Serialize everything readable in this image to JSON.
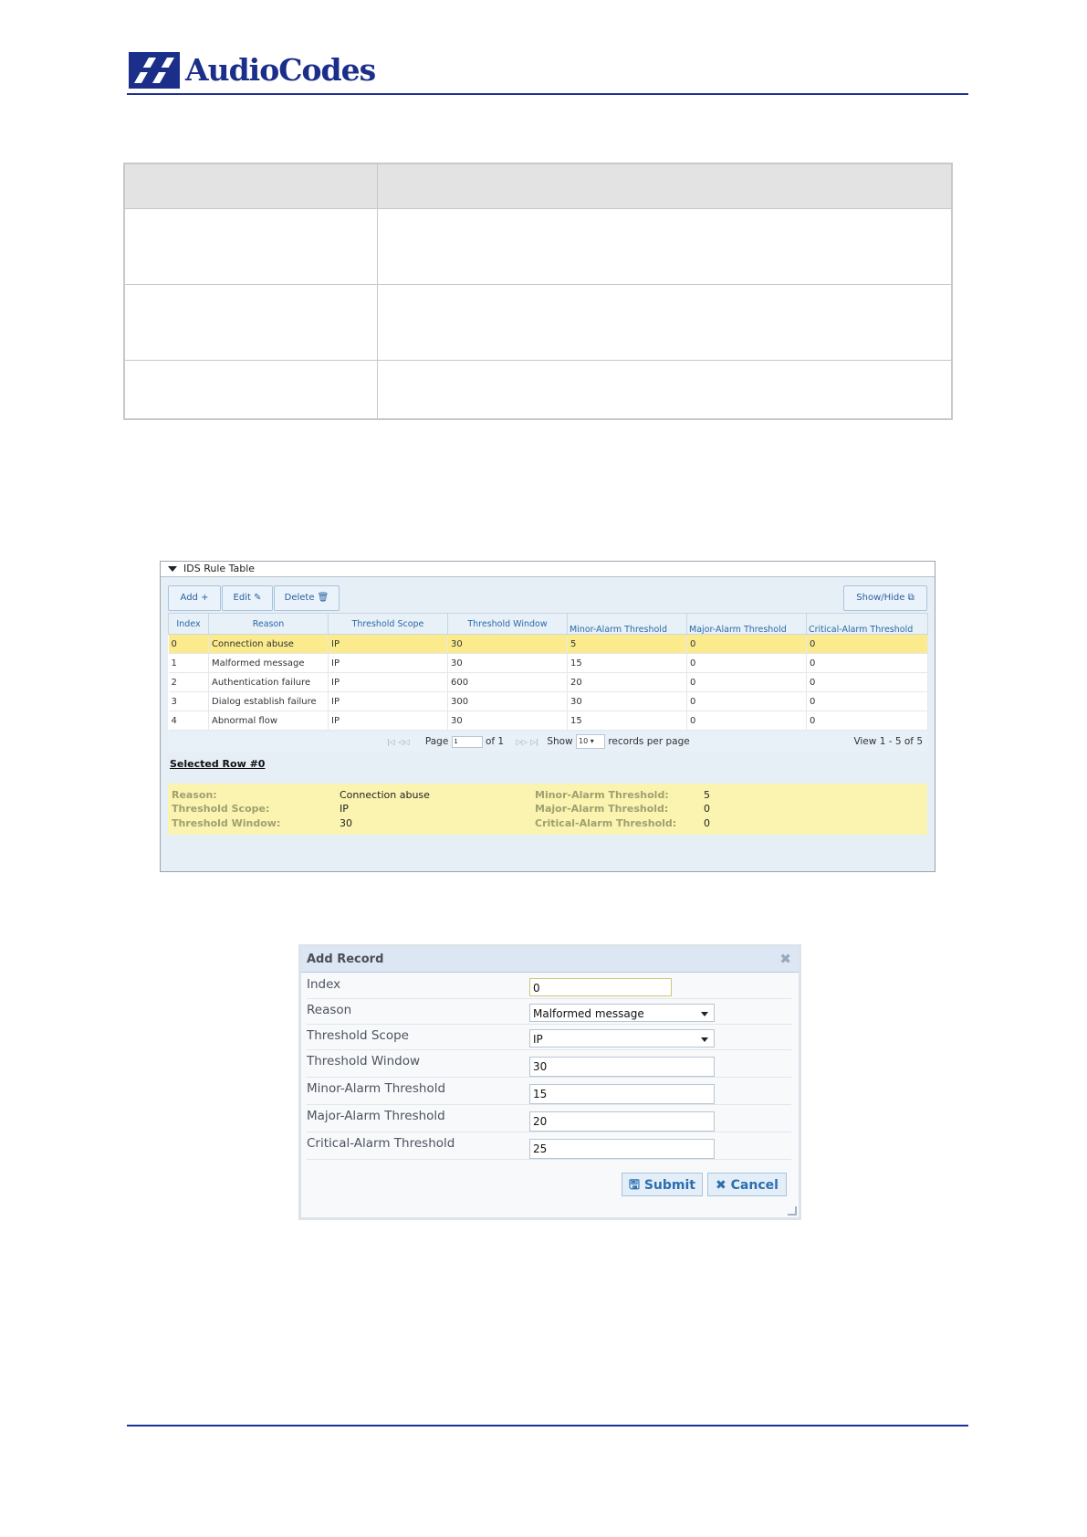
{
  "header": {
    "logo_text": "AudioCodes"
  },
  "ids_table": {
    "title": "IDS Rule Table",
    "toolbar": {
      "add": "Add +",
      "edit": "Edit ✎",
      "delete": "Delete 🗑",
      "show_hide": "Show/Hide ⧉"
    },
    "columns": [
      "Index",
      "Reason",
      "Threshold Scope",
      "Threshold Window",
      "Minor-Alarm Threshold",
      "Major-Alarm Threshold",
      "Critical-Alarm Threshold"
    ],
    "rows": [
      [
        "0",
        "Connection abuse",
        "IP",
        "30",
        "5",
        "0",
        "0"
      ],
      [
        "1",
        "Malformed message",
        "IP",
        "30",
        "15",
        "0",
        "0"
      ],
      [
        "2",
        "Authentication failure",
        "IP",
        "600",
        "20",
        "0",
        "0"
      ],
      [
        "3",
        "Dialog establish failure",
        "IP",
        "300",
        "30",
        "0",
        "0"
      ],
      [
        "4",
        "Abnormal flow",
        "IP",
        "30",
        "15",
        "0",
        "0"
      ]
    ],
    "pager": {
      "page_label": "Page",
      "page_value": "1",
      "of_label": "of 1",
      "show_label": "Show",
      "show_value": "10",
      "records_label": "records per page",
      "view_label": "View 1 - 5 of 5"
    },
    "selected_row": "Selected Row #0",
    "details": {
      "reason_label": "Reason:",
      "reason_value": "Connection abuse",
      "scope_label": "Threshold Scope:",
      "scope_value": "IP",
      "window_label": "Threshold Window:",
      "window_value": "30",
      "minor_label": "Minor-Alarm Threshold:",
      "minor_value": "5",
      "major_label": "Major-Alarm Threshold:",
      "major_value": "0",
      "critical_label": "Critical-Alarm Threshold:",
      "critical_value": "0"
    }
  },
  "add_record": {
    "title": "Add Record",
    "fields": [
      {
        "label": "Index",
        "value": "0"
      },
      {
        "label": "Reason",
        "value": "Malformed message"
      },
      {
        "label": "Threshold Scope",
        "value": "IP"
      },
      {
        "label": "Threshold Window",
        "value": "30"
      },
      {
        "label": "Minor-Alarm Threshold",
        "value": "15"
      },
      {
        "label": "Major-Alarm Threshold",
        "value": "20"
      },
      {
        "label": "Critical-Alarm Threshold",
        "value": "25"
      }
    ],
    "submit": "Submit",
    "cancel": "Cancel"
  },
  "colors": {
    "brand": "#1b2f8a",
    "rule": "#1e2f93",
    "selected_row": "#fbeb8c",
    "details_bg": "#fbf4b0",
    "link_blue": "#2a6aa8"
  },
  "icons": [
    "audiocodes-logo-mark",
    "collapse-triangle-icon",
    "save-icon",
    "close-icon",
    "dropdown-arrow-icon"
  ]
}
